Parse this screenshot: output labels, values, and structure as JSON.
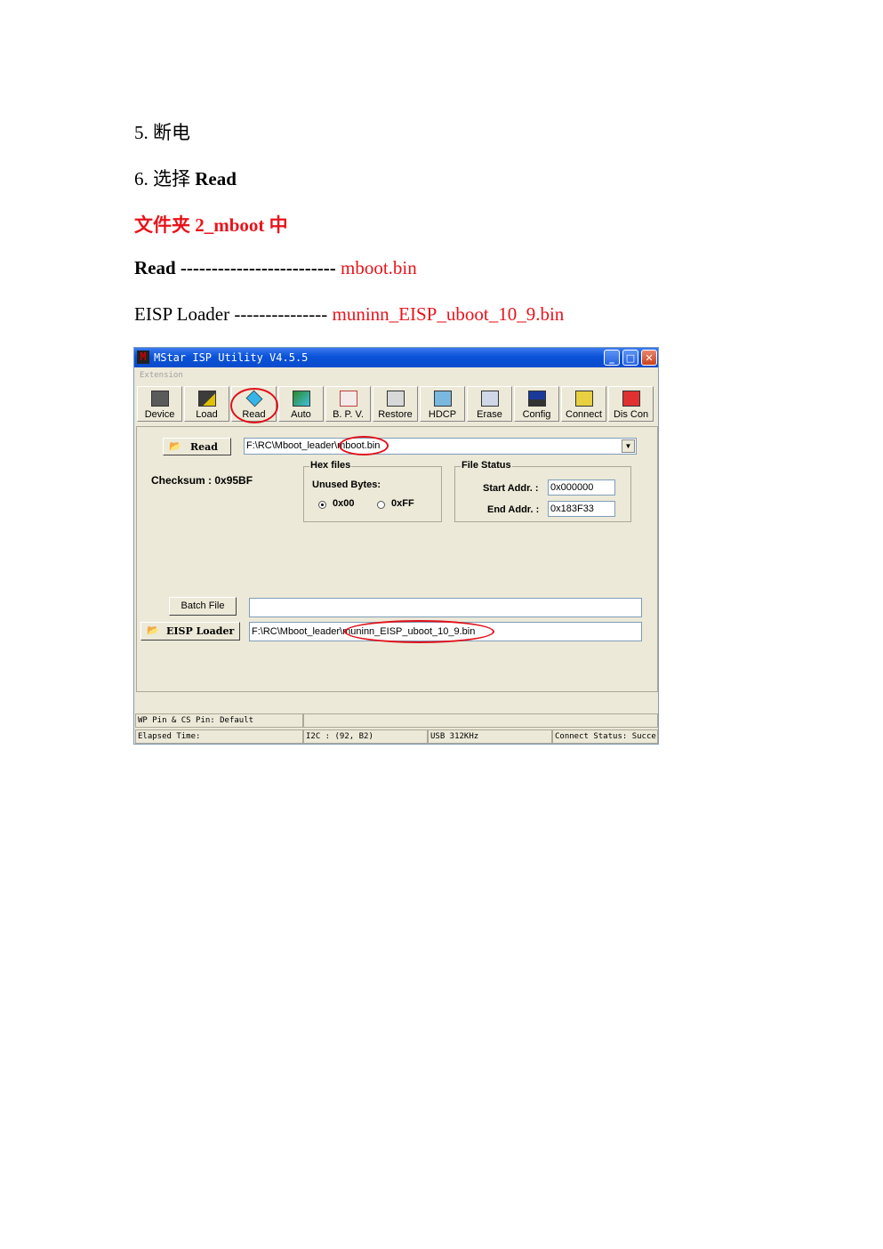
{
  "doc": {
    "step5": "5.  断电",
    "step6_prefix": "6.  选择 ",
    "step6_bold": "Read",
    "folder_note": "文件夹 2_mboot 中",
    "read_label": "Read ------------------------- ",
    "read_file": "mboot.bin",
    "eisp_label": "EISP Loader --------------- ",
    "eisp_file": "muninn_EISP_uboot_10_9.bin"
  },
  "window": {
    "logo": "M",
    "title": "MStar ISP Utility V4.5.5",
    "menu_extension": "Extension",
    "toolbar": [
      "Device",
      "Load",
      "Read",
      "Auto",
      "B. P. V.",
      "Restore",
      "HDCP",
      "Erase",
      "Config",
      "Connect",
      "Dis Con"
    ],
    "read_button": "Read",
    "read_path": "F:\\RC\\Mboot_leader\\mboot.bin",
    "checksum": "Checksum : 0x95BF",
    "hex_files": {
      "title": "Hex files",
      "unused_bytes": "Unused Bytes:",
      "opt1": "0x00",
      "opt2": "0xFF"
    },
    "file_status": {
      "title": "File Status",
      "start_label": "Start Addr. :",
      "start_value": "0x000000",
      "end_label": "End Addr. :",
      "end_value": "0x183F33"
    },
    "batch_button": "Batch File",
    "batch_path": "",
    "eisp_button": "EISP Loader",
    "eisp_path": "F:\\RC\\Mboot_leader\\muninn_EISP_uboot_10_9.bin",
    "status": {
      "wp_pin": "WP Pin & CS Pin: Default",
      "elapsed": "Elapsed Time:",
      "i2c": "I2C :  (92, B2)",
      "usb": "USB  312KHz",
      "connect": "Connect Status: Succe"
    }
  },
  "colors": {
    "accent_red": "#e8141b",
    "titlebar_blue": "#0a52d8"
  }
}
